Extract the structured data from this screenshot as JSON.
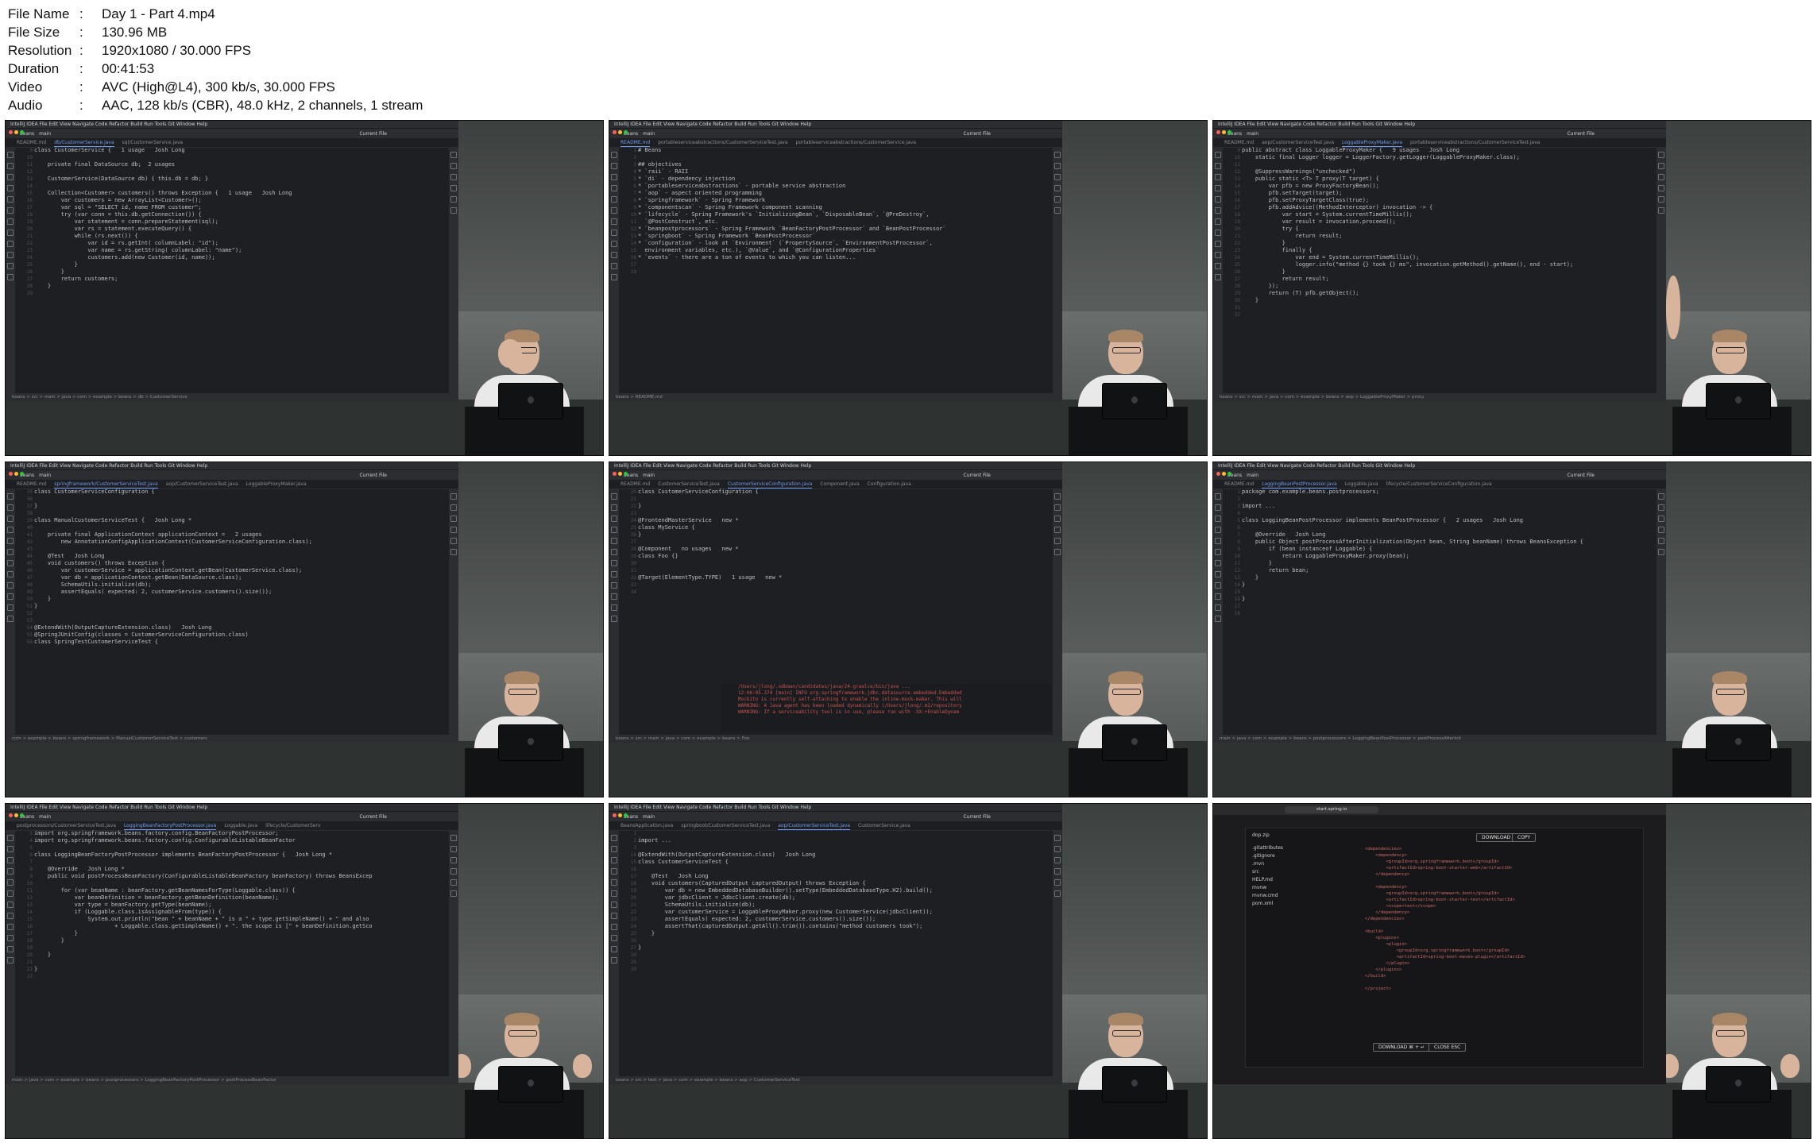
{
  "file_info": [
    {
      "key": "File Name",
      "value": "Day 1 - Part 4.mp4"
    },
    {
      "key": "File Size",
      "value": "130.96 MB"
    },
    {
      "key": "Resolution",
      "value": "1920x1080 / 30.000 FPS"
    },
    {
      "key": "Duration",
      "value": "00:41:53"
    },
    {
      "key": "Video",
      "value": "AVC (High@L4), 300 kb/s, 30.000 FPS"
    },
    {
      "key": "Audio",
      "value": "AAC, 128 kb/s (CBR), 48.0 kHz, 2 channels, 1 stream"
    }
  ],
  "separator": ":",
  "common": {
    "menu": "IntelliJ IDEA   File   Edit   View   Navigate   Code   Refactor   Build   Run   Tools   Git   Window   Help",
    "project": "beans",
    "branch": "main",
    "run_config": "Current File"
  },
  "thumbs": [
    {
      "tabs": [
        "README.md",
        "db/CustomerService.java",
        "sql/CustomerService.java"
      ],
      "active_tab": 1,
      "lines": "9\n10\n11\n12\n13\n14\n15\n16\n17\n18\n19\n20\n21\n22\n23\n24\n25\n26\n27\n28\n29",
      "code": "class CustomerService {   1 usage   Josh Long\n\n    private final DataSource db;  2 usages\n\n    CustomerService(DataSource db) { this.db = db; }\n\n    Collection<Customer> customers() throws Exception {   1 usage   Josh Long\n        var customers = new ArrayList<Customer>();\n        var sql = \"SELECT id, name FROM customer\";\n        try (var conn = this.db.getConnection()) {\n            var statement = conn.prepareStatement(sql);\n            var rs = statement.executeQuery() {\n            while (rs.next()) {\n                var id = rs.getInt( columnLabel: \"id\");\n                var name = rs.getString( columnLabel: \"name\");\n                customers.add(new Customer(id, name));\n            }\n        }\n        return customers;\n    }",
      "status": "beans > src > main > java > com > example > beans > db > CustomerService",
      "speaker": "facepalm"
    },
    {
      "tabs": [
        "README.md",
        "portableserviceabstractions/CustomerServiceTest.java",
        "portableserviceabstractions/CustomerService.java"
      ],
      "active_tab": 0,
      "lines": "1\n2\n3\n4\n5\n6\n7\n8\n9\n10\n11\n12\n13\n14\n15\n16\n17\n18",
      "code": "# Beans\n\n## objectives\n* `raii` - RAII\n* `di` - dependency injection\n* `portableserviceabstractions` - portable service abstraction\n* `aop` - aspect oriented programming\n* `springframework` - Spring Framework\n* `componentscan` - Spring Framework component scanning\n* `lifecycle` - Spring Framework's `InitializingBean`, `DisposableBean`, `@PreDestroy`,\n  `@PostConstruct`, etc.\n* `beanpostprocessors` - Spring Framework `BeanFactoryPostProcessor` and `BeanPostProcessor`\n* `springboot` - Spring Framework `BeanPostProcessor`\n* `configuration` - look at `Environment` (`PropertySource`, `EnvironmentPostProcessor`,\n  environment variables, etc.), `@Value`, and `@ConfigurationProperties`\n* `events` - there are a ton of events to which you can listen...",
      "status": "beans > README.md",
      "speaker": "talk"
    },
    {
      "tabs": [
        "README.md",
        "aop/CustomerServiceTest.java",
        "LoggableProxyMaker.java",
        "portableserviceabstractions/CustomerServiceTest.java"
      ],
      "active_tab": 2,
      "lines": "9\n10\n11\n12\n13\n14\n15\n16\n17\n18\n19\n20\n21\n22\n23\n24\n25\n26\n27\n28\n29\n30\n31\n32",
      "code": "public abstract class LoggableProxyMaker {   9 usages   Josh Long\n    static final Logger logger = LoggerFactory.getLogger(LoggableProxyMaker.class);\n\n    @SuppressWarnings(\"unchecked\")\n    public static <T> T proxy(T target) {\n        var pfb = new ProxyFactoryBean();\n        pfb.setTarget(target);\n        pfb.setProxyTargetClass(true);\n        pfb.addAdvice((MethodInterceptor) invocation -> {\n            var start = System.currentTimeMillis();\n            var result = invocation.proceed();\n            try {\n                return result;\n            }\n            finally {\n                var end = System.currentTimeMillis();\n                logger.info(\"method {} took {} ms\", invocation.getMethod().getName(), end - start);\n            }\n            return result;\n        });\n        return (T) pfb.getObject();\n    }",
      "status": "beans > src > main > java > com > example > beans > aop > LoggableProxyMaker > proxy",
      "speaker": "wave"
    },
    {
      "tabs": [
        "README.md",
        "springframework/CustomerServiceTest.java",
        "aop/CustomerServiceTest.java",
        "LoggableProxyMaker.java"
      ],
      "active_tab": 1,
      "lines": "35\n36\n37\n38\n39\n40\n41\n42\n43\n44\n45\n46\n47\n48\n49\n50\n51\n52\n53\n54\n55\n56",
      "code": "class CustomerServiceConfiguration {\n\n}\n\nclass ManualCustomerServiceTest {   Josh Long *\n\n    private final ApplicationContext applicationContext =   2 usages\n        new AnnotationConfigApplicationContext(CustomerServiceConfiguration.class);\n\n    @Test   Josh Long\n    void customers() throws Exception {\n        var customerService = applicationContext.getBean(CustomerService.class);\n        var db = applicationContext.getBean(DataSource.class);\n        SchemaUtils.initialize(db);\n        assertEquals( expected: 2, customerService.customers().size());\n    }\n}\n\n\n@ExtendWith(OutputCaptureExtension.class)   Josh Long\n@SpringJUnitConfig(classes = CustomerServiceConfiguration.class)\nclass SpringTestCustomerServiceTest {",
      "status": "com > example > beans > springframework > ManualCustomerServiceTest > customers",
      "speaker": "talk"
    },
    {
      "tabs": [
        "README.md",
        "CustomerServiceTest.java",
        "CustomerServiceConfiguration.java",
        "Component.java",
        "Configuration.java"
      ],
      "active_tab": 2,
      "lines": "20\n21\n22\n23\n24\n25\n26\n27\n28\n29\n30\n31\n32\n33\n34",
      "code": "class CustomerServiceConfiguration {\n\n}\n\n@FrontendMasterService   new *\nclass MyService {\n}\n\n@Component   no usages   new *\nclass Foo {}\n\n\n@Target(ElementType.TYPE)   1 usage   new *",
      "console": "/Users/jlong/.sdkman/candidates/java/24-graalce/bin/java ...\n12:06:05.374 [main] INFO org.springframework.jdbc.datasource.embedded.Embedded\nMockito is currently self-attaching to enable the inline-mock-maker. This will\nWARNING: A Java agent has been loaded dynamically (/Users/jlong/.m2/repository\nWARNING: If a serviceability tool is in use, please run with -XX:+EnableDynam",
      "status": "beans > src > main > java > com > example > beans > Foo",
      "speaker": "talk"
    },
    {
      "tabs": [
        "README.md",
        "LoggingBeanPostProcessor.java",
        "Loggable.java",
        "lifecycle/CustomerServiceConfiguration.java"
      ],
      "active_tab": 1,
      "lines": "1\n2\n3\n4\n5\n6\n7\n8\n9\n10\n11\n12\n13\n14\n15\n16\n17\n18",
      "code": "package com.example.beans.postprocessors;\n\nimport ...\n\nclass LoggingBeanPostProcessor implements BeanPostProcessor {   2 usages   Josh Long\n\n    @Override   Josh Long\n    public Object postProcessAfterInitialization(Object bean, String beanName) throws BeansException {\n        if (bean instanceof Loggable) {\n            return LoggableProxyMaker.proxy(bean);\n        }\n        return bean;\n    }\n}\n\n}",
      "status": "main > java > com > example > beans > postprocessors > LoggingBeanPostProcessor > postProcessAfterInit",
      "speaker": "talk"
    },
    {
      "tabs": [
        "postprocessors/CustomerServiceTest.java",
        "LoggingBeanFactoryPostProcessor.java",
        "Loggable.java",
        "lifecycle/CustomerServ"
      ],
      "active_tab": 1,
      "lines": "3\n4\n5\n6\n7\n8\n9\n10\n11\n12\n13\n14\n15\n16\n17\n18\n19\n20\n21\n22\n23",
      "code": "import org.springframework.beans.factory.config.BeanFactoryPostProcessor;\nimport org.springframework.beans.factory.config.ConfigurableListableBeanFactor\n\nclass LoggingBeanFactoryPostProcessor implements BeanFactoryPostProcessor {   Josh Long *\n\n    @Override   Josh Long *\n    public void postProcessBeanFactory(ConfigurableListableBeanFactory beanFactory) throws BeansExcep\n\n        for (var beanName : beanFactory.getBeanNamesForType(Loggable.class)) {\n            var beanDefinition = beanFactory.getBeanDefinition(beanName);\n            var type = beanFactory.getType(beanName);\n            if (Loggable.class.isAssignableFrom(type)) {\n                System.out.println(\"bean \" + beanName + \" is a \" + type.getSimpleName() + \" and also\n                        + Loggable.class.getSimpleName() + \". the scope is [\" + beanDefinition.getSco\n            }\n        }\n\n    }\n\n}",
      "status": "main > java > com > example > beans > postprocessors > LoggingBeanFactoryPostProcessor > postProcessBeanFactor",
      "speaker": "hands"
    },
    {
      "tabs": [
        "BeansApplication.java",
        "springboot/CustomerServiceTest.java",
        "aop/CustomerServiceTest.java",
        "CustomerService.java"
      ],
      "active_tab": 2,
      "lines": "1\n2\n3\n14\n15\n16\n17\n18\n19\n20\n21\n22\n23\n24\n25\n26\n27\n28\n29\n30",
      "code": "\nimport ...\n\n@ExtendWith(OutputCaptureExtension.class)   Josh Long\nclass CustomerServiceTest {\n\n    @Test   Josh Long\n    void customers(CapturedOutput capturedOutput) throws Exception {\n        var db = new EmbeddedDatabaseBuilder().setType(EmbeddedDatabaseType.H2).build();\n        var jdbcClient = JdbcClient.create(db);\n        SchemaUtils.initialize(db);\n        var customerService = LoggableProxyMaker.proxy(new CustomerService(jdbcClient));\n        assertEquals( expected: 2, customerService.customers().size());\n        assertThat(capturedOutput.getAll().trim()).contains(\"method customers took\");\n    }\n\n}",
      "status": "beans > src > test > java > com > example > beans > aop > CustomerServiceTest",
      "speaker": "talk"
    }
  ],
  "browser": {
    "url": "start.spring.io",
    "zip_name": "dop.zip",
    "files": ".gitattributes\n.gitignore\n.mvn\nsrc\nHELP.md\nmvnw\nmvnw.cmd\npom.xml",
    "pom": "<dependencies>\n    <dependency>\n        <groupId>org.springframework.boot</groupId>\n        <artifactId>spring-boot-starter-web</artifactId>\n    </dependency>\n\n    <dependency>\n        <groupId>org.springframework.boot</groupId>\n        <artifactId>spring-boot-starter-test</artifactId>\n        <scope>test</scope>\n    </dependency>\n</dependencies>\n\n<build>\n    <plugins>\n        <plugin>\n            <groupId>org.springframework.boot</groupId>\n            <artifactId>spring-boot-maven-plugin</artifactId>\n        </plugin>\n    </plugins>\n</build>\n\n</project>",
    "download_top": "DOWNLOAD",
    "copy": "COPY",
    "download_bottom": "DOWNLOAD ⌘ + ↵",
    "close": "CLOSE  ESC"
  }
}
